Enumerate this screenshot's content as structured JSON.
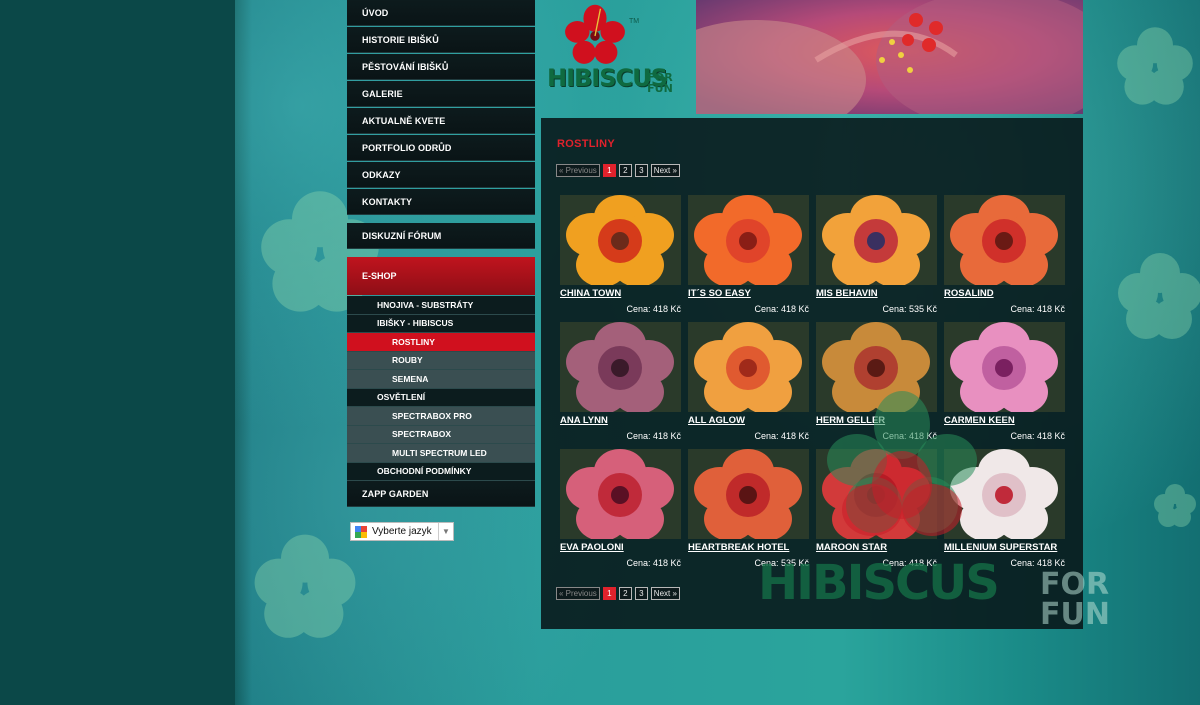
{
  "colors": {
    "accent": "#e0222c",
    "panel": "#0a1416",
    "background": "#2a9e9c"
  },
  "nav": {
    "items": [
      "ÚVOD",
      "HISTORIE IBIŠKŮ",
      "PĚSTOVÁNÍ IBIŠKŮ",
      "GALERIE",
      "AKTUALNĚ KVETE",
      "PORTFOLIO ODRŮD",
      "ODKAZY",
      "KONTAKTY"
    ],
    "forum": "DISKUZNÍ FÓRUM",
    "eshop": "E-SHOP",
    "sub": [
      {
        "label": "HNOJIVA - SUBSTRÁTY",
        "level": 1
      },
      {
        "label": "IBIŠKY - HIBISCUS",
        "level": 1
      },
      {
        "label": "ROSTLINY",
        "level": 2,
        "active": true
      },
      {
        "label": "ROUBY",
        "level": 2
      },
      {
        "label": "SEMENA",
        "level": 2
      },
      {
        "label": "OSVĚTLENÍ",
        "level": 1
      },
      {
        "label": "SPECTRABOX PRO",
        "level": 2
      },
      {
        "label": "SPECTRABOX",
        "level": 2
      },
      {
        "label": "MULTI SPECTRUM LED",
        "level": 2
      },
      {
        "label": "OBCHODNÍ PODMÍNKY",
        "level": 1
      }
    ],
    "last": "ZAPP GARDEN"
  },
  "language": {
    "label": "Vyberte jazyk",
    "icon": "google-icon"
  },
  "logo": {
    "brand": "HIBISCUS",
    "for": "FOR",
    "fun": "FUN",
    "tm": "TM"
  },
  "page": {
    "title": "ROSTLINY"
  },
  "pagination": {
    "previous": "« Previous",
    "pages": [
      "1",
      "2",
      "3"
    ],
    "current": "1",
    "next": "Next »"
  },
  "products": [
    {
      "name": "CHINA TOWN",
      "price": "Cena: 418 Kč",
      "colors": [
        "#f0a020",
        "#d53b1a",
        "#6b2a1a"
      ]
    },
    {
      "name": "IT´S SO EASY",
      "price": "Cena: 418 Kč",
      "colors": [
        "#f26a2a",
        "#e0442a",
        "#8a1e16"
      ]
    },
    {
      "name": "MIS BEHAVIN",
      "price": "Cena: 535 Kč",
      "colors": [
        "#f2a23a",
        "#c43a3a",
        "#3a3060"
      ]
    },
    {
      "name": "ROSALIND",
      "price": "Cena: 418 Kč",
      "colors": [
        "#e86a3a",
        "#d0302a",
        "#6a1a14"
      ]
    },
    {
      "name": "ANA LYNN",
      "price": "Cena: 418 Kč",
      "colors": [
        "#a4607a",
        "#7a3a5a",
        "#3a1a2a"
      ]
    },
    {
      "name": "ALL AGLOW",
      "price": "Cena: 418 Kč",
      "colors": [
        "#f0a040",
        "#e05a30",
        "#a02a1a"
      ]
    },
    {
      "name": "HERM GELLER",
      "price": "Cena: 418 Kč",
      "colors": [
        "#c88a3a",
        "#b04030",
        "#5a1a14"
      ]
    },
    {
      "name": "CARMEN KEEN",
      "price": "Cena: 418 Kč",
      "colors": [
        "#e890c0",
        "#c060a0",
        "#7a2060"
      ]
    },
    {
      "name": "EVA PAOLONI",
      "price": "Cena: 418 Kč",
      "colors": [
        "#d6607a",
        "#c02a3a",
        "#5a1024"
      ]
    },
    {
      "name": "HEARTBREAK HOTEL",
      "price": "Cena: 535 Kč",
      "colors": [
        "#e0603a",
        "#c02a2a",
        "#5a1414"
      ]
    },
    {
      "name": "MAROON STAR",
      "price": "Cena: 418 Kč",
      "colors": [
        "#d23a3a",
        "#a01a22",
        "#50101a"
      ]
    },
    {
      "name": "MILLENIUM SUPERSTAR",
      "price": "Cena: 418 Kč",
      "colors": [
        "#f0e8e8",
        "#e0c0c8",
        "#c02a3a"
      ]
    }
  ],
  "watermark": {
    "brand": "HIBISCUS",
    "for": "FOR",
    "fun": "FUN"
  }
}
